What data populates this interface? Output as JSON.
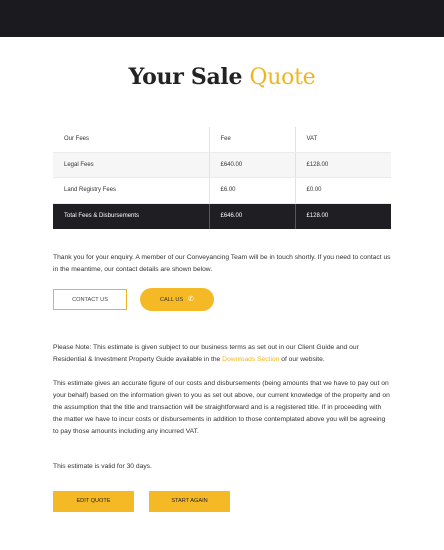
{
  "header": {
    "title_main": "Your Sale",
    "title_accent": "Quote"
  },
  "fees_table": {
    "columns": [
      "Our Fees",
      "Fee",
      "VAT"
    ],
    "rows": [
      {
        "label": "Legal Fees",
        "fee": "£640.00",
        "vat": "£128.00"
      },
      {
        "label": "Land Registry Fees",
        "fee": "£6.00",
        "vat": "£0.00"
      }
    ],
    "total": {
      "label": "Total Fees & Disbursements",
      "fee": "£646.00",
      "vat": "£128.00"
    }
  },
  "thanks_text": "Thank you for your enquiry. A member of our Conveyancing Team will be in touch shortly. If you need to contact us in the meantime, our contact details are shown below.",
  "buttons": {
    "contact_us": "CONTACT US",
    "call_us": "CALL US",
    "call_icon": "phone-icon",
    "edit_quote": "EDIT QUOTE",
    "start_again": "START AGAIN"
  },
  "note": {
    "before_link": "Please Note: This estimate is given subject to our business terms as set out in our Client Guide and our Residential & Investment Property Guide available in the ",
    "link_text": "Downloads Section",
    "after_link": " of our website."
  },
  "estimate_text": "This estimate gives an accurate figure of our costs and disbursements (being amounts that we have to pay out on your behalf) based on the information given to you as set out above, our current knowledge of the property and on the assumption that the title and transaction will be straightforward and is a registered title. If in proceeding with the matter we have to incur costs or disbursements in addition to those contemplated above you will be agreeing to pay those amounts including any incurred VAT.",
  "validity_text": "This estimate is valid for 30 days.",
  "colors": {
    "accent": "#f0b51e",
    "dark": "#1f1f23"
  }
}
